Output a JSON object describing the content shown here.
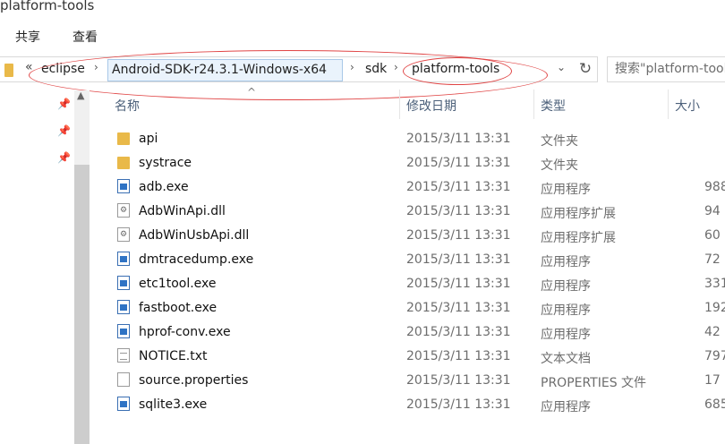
{
  "window": {
    "title": "platform-tools"
  },
  "ribbon": {
    "tabs": [
      "共享",
      "查看"
    ]
  },
  "address": {
    "lead": "«",
    "crumbs": [
      "eclipse",
      "Android-SDK-r24.3.1-Windows-x64",
      "sdk",
      "platform-tools"
    ],
    "separator": "›",
    "dropdown": "⌄",
    "refresh": "↻"
  },
  "search": {
    "placeholder": "搜索\"platform-tools\""
  },
  "columns": {
    "name": "名称",
    "date": "修改日期",
    "type": "类型",
    "size": "大小"
  },
  "files": [
    {
      "name": "api",
      "date": "2015/3/11 13:31",
      "type": "文件夹",
      "size": "",
      "icon": "folder-icon"
    },
    {
      "name": "systrace",
      "date": "2015/3/11 13:31",
      "type": "文件夹",
      "size": "",
      "icon": "folder-icon"
    },
    {
      "name": "adb.exe",
      "date": "2015/3/11 13:31",
      "type": "应用程序",
      "size": "988",
      "icon": "exe-icon"
    },
    {
      "name": "AdbWinApi.dll",
      "date": "2015/3/11 13:31",
      "type": "应用程序扩展",
      "size": "94",
      "icon": "dll-icon"
    },
    {
      "name": "AdbWinUsbApi.dll",
      "date": "2015/3/11 13:31",
      "type": "应用程序扩展",
      "size": "60",
      "icon": "dll-icon"
    },
    {
      "name": "dmtracedump.exe",
      "date": "2015/3/11 13:31",
      "type": "应用程序",
      "size": "72",
      "icon": "exe-icon"
    },
    {
      "name": "etc1tool.exe",
      "date": "2015/3/11 13:31",
      "type": "应用程序",
      "size": "331",
      "icon": "exe-icon"
    },
    {
      "name": "fastboot.exe",
      "date": "2015/3/11 13:31",
      "type": "应用程序",
      "size": "192",
      "icon": "exe-icon"
    },
    {
      "name": "hprof-conv.exe",
      "date": "2015/3/11 13:31",
      "type": "应用程序",
      "size": "42",
      "icon": "exe-icon"
    },
    {
      "name": "NOTICE.txt",
      "date": "2015/3/11 13:31",
      "type": "文本文档",
      "size": "797",
      "icon": "txt-icon"
    },
    {
      "name": "source.properties",
      "date": "2015/3/11 13:31",
      "type": "PROPERTIES 文件",
      "size": "17",
      "icon": "file-icon"
    },
    {
      "name": "sqlite3.exe",
      "date": "2015/3/11 13:31",
      "type": "应用程序",
      "size": "685",
      "icon": "exe-icon"
    }
  ],
  "colors": {
    "annotation": "#e04545",
    "header_text": "#4c607a",
    "folder": "#e9b949",
    "exe_blue": "#2f73c4"
  }
}
